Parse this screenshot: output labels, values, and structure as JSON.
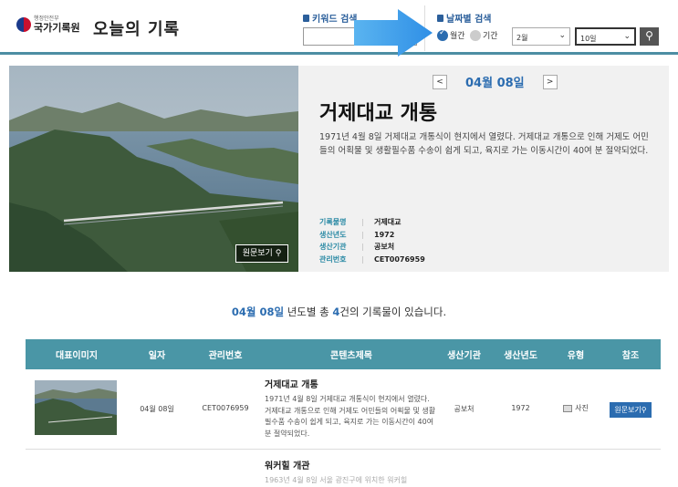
{
  "header": {
    "org_top": "행정안전부",
    "org_name": "국가기록원",
    "site_title": "오늘의 기록",
    "keyword_search_label": "키워드 검색",
    "keyword_input_value": "",
    "date_search_label": "날짜별 검색",
    "radio_monthly": "월간",
    "radio_period": "기간",
    "month_select": "2월",
    "day_select": "10일",
    "search_button": "검색"
  },
  "hero": {
    "nav_prev": "<",
    "nav_next": ">",
    "date": "04월 08일",
    "title": "거제대교 개통",
    "description": "1971년 4월 8일 거제대교 개통식이 현지에서 열렸다. 거제대교 개통으로 인해 거제도 어민들의 어획물 및 생활필수품 수송이 쉽게 되고, 육지로 가는 이동시간이 40여 분 절약되었다.",
    "original_button": "원문보기",
    "meta": [
      {
        "key": "기록물명",
        "value": "거제대교"
      },
      {
        "key": "생산년도",
        "value": "1972"
      },
      {
        "key": "생산기관",
        "value": "공보처"
      },
      {
        "key": "관리번호",
        "value": "CET0076959"
      }
    ]
  },
  "summary": {
    "date": "04월 08일",
    "text_mid": " 년도별 총 ",
    "count": "4",
    "text_end": "건의 기록물이 있습니다."
  },
  "table": {
    "headers": [
      "대표이미지",
      "일자",
      "관리번호",
      "콘텐츠제목",
      "생산기관",
      "생산년도",
      "유형",
      "참조"
    ],
    "rows": [
      {
        "date": "04월 08일",
        "id": "CET0076959",
        "title": "거제대교 개통",
        "desc": "1971년 4월 8일 거제대교 개통식이 현지에서 열렸다. 거제대교 개통으로 인해 거제도 어민들의 어획물 및 생활필수품 수송이 쉽게 되고, 육지로 가는 이동시간이 40여 분 절약되었다.",
        "agency": "공보처",
        "year": "1972",
        "type": "사진",
        "ref": "원문보기"
      },
      {
        "title": "워커힐 개관",
        "desc": "1963년 4월 8일 서울 광진구에 위치한 워커힐"
      }
    ]
  },
  "colors": {
    "accent": "#2b6cb0",
    "table_header": "#4a96a6",
    "meta_key": "#2b8aa5"
  }
}
